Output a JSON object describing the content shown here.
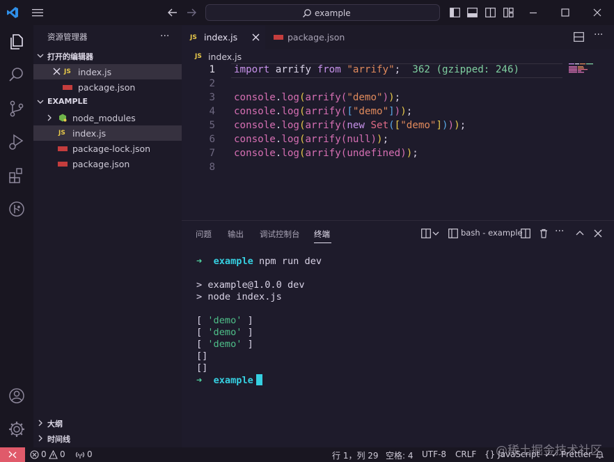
{
  "titlebar": {
    "search_text": "example"
  },
  "sidebar": {
    "title": "资源管理器",
    "more_label": "···",
    "open_editors": {
      "header": "打开的编辑器",
      "items": [
        {
          "name": "index.js",
          "badge": "JS"
        },
        {
          "name": "package.json",
          "badge": "npm"
        }
      ]
    },
    "project": {
      "header": "EXAMPLE",
      "items": [
        {
          "name": "node_modules",
          "kind": "folder"
        },
        {
          "name": "index.js",
          "kind": "js",
          "badge": "JS"
        },
        {
          "name": "package-lock.json",
          "kind": "npm"
        },
        {
          "name": "package.json",
          "kind": "npm"
        }
      ]
    },
    "outline": "大纲",
    "timeline": "时间线"
  },
  "tabs": [
    {
      "label": "index.js",
      "badge": "JS",
      "active": true
    },
    {
      "label": "package.json",
      "badge": "npm",
      "active": false
    }
  ],
  "editor_more": "···",
  "breadcrumb": {
    "badge": "JS",
    "file": "index.js"
  },
  "code": {
    "line_numbers": [
      "1",
      "2",
      "3",
      "4",
      "5",
      "6",
      "7",
      "8"
    ],
    "tokens": {
      "import_kw": "import",
      "arrify": "arrify",
      "from_kw": "from",
      "module_str": "\"arrify\"",
      "semi": ";",
      "size_hint": "362 (gzipped: 246)",
      "console": "console",
      "log": "log",
      "demo_str": "\"demo\"",
      "new_kw": "new",
      "set_cls": "Set",
      "null_lit": "null",
      "undefined_lit": "undefined"
    }
  },
  "panel": {
    "tabs": [
      "问题",
      "输出",
      "调试控制台",
      "终端"
    ],
    "terminal_name": "bash - example",
    "more": "···",
    "prompt_arrow": "➜",
    "project": "example",
    "command": "npm run dev",
    "output": [
      "> example@1.0.0 dev",
      "> node index.js"
    ],
    "result_demo": "'demo'",
    "empty_array": "[]"
  },
  "statusbar": {
    "errors": "0",
    "warnings": "0",
    "ports": "0",
    "position": "行 1，列 29",
    "spaces": "空格: 4",
    "encoding": "UTF-8",
    "eol": "CRLF",
    "language": "{} JavaScript",
    "prettier": "✓✓ Prettier"
  },
  "watermark": "@稀土掘金技术社区",
  "colors": {
    "accent_cyan": "#36cfe0",
    "remote_badge": "#e05a6a",
    "js_yellow": "#e8c94a",
    "npm_red": "#c43d3d"
  }
}
